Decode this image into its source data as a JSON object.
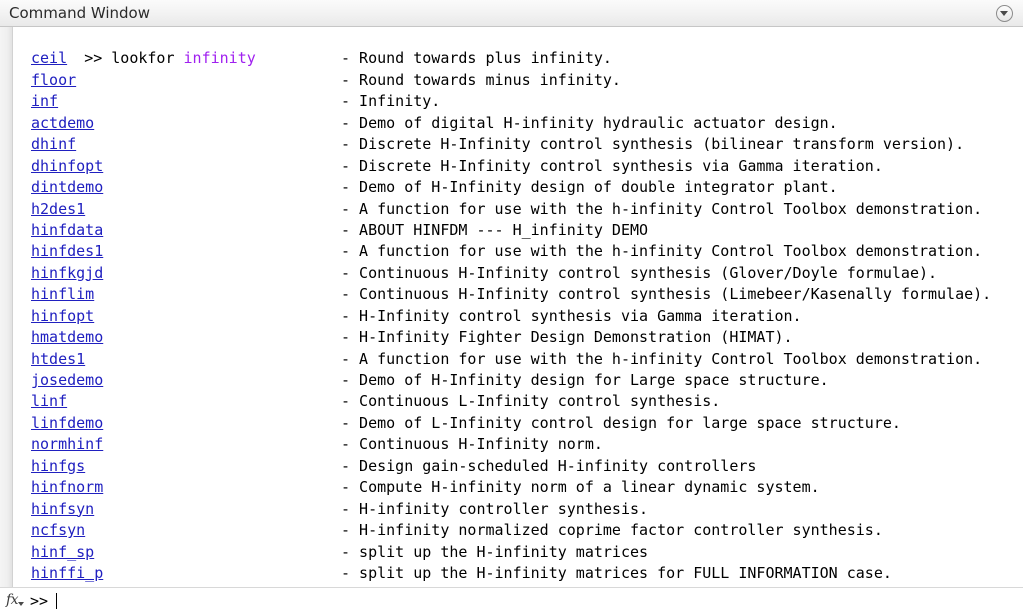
{
  "window": {
    "title": "Command Window",
    "menu_icon": "chevron-down-circle-icon"
  },
  "command": {
    "prompt": ">> ",
    "name": "lookfor",
    "space": " ",
    "argument": "infinity",
    "accent_color": "#a020f0"
  },
  "results": {
    "link_color": "#2020c0",
    "items": [
      {
        "name": "ceil",
        "desc": "- Round towards plus infinity."
      },
      {
        "name": "floor",
        "desc": "- Round towards minus infinity."
      },
      {
        "name": "inf",
        "desc": "- Infinity."
      },
      {
        "name": "actdemo",
        "desc": "- Demo of digital H-infinity hydraulic actuator design."
      },
      {
        "name": "dhinf",
        "desc": "- Discrete H-Infinity control synthesis (bilinear transform version)."
      },
      {
        "name": "dhinfopt",
        "desc": "- Discrete H-Infinity control synthesis via Gamma iteration."
      },
      {
        "name": "dintdemo",
        "desc": "- Demo of H-Infinity design of double integrator plant."
      },
      {
        "name": "h2des1",
        "desc": "- A function for use with the h-infinity Control Toolbox demonstration."
      },
      {
        "name": "hinfdata",
        "desc": "- ABOUT HINFDM --- H_infinity DEMO"
      },
      {
        "name": "hinfdes1",
        "desc": "- A function for use with the h-infinity Control Toolbox demonstration."
      },
      {
        "name": "hinfkgjd",
        "desc": "- Continuous H-Infinity control synthesis (Glover/Doyle formulae)."
      },
      {
        "name": "hinflim",
        "desc": "- Continuous H-Infinity control synthesis (Limebeer/Kasenally formulae)."
      },
      {
        "name": "hinfopt",
        "desc": "- H-Infinity control synthesis via Gamma iteration."
      },
      {
        "name": "hmatdemo",
        "desc": "- H-Infinity Fighter Design Demonstration (HIMAT)."
      },
      {
        "name": "htdes1",
        "desc": "- A function for use with the h-infinity Control Toolbox demonstration."
      },
      {
        "name": "josedemo",
        "desc": "- Demo of H-Infinity design for Large space structure."
      },
      {
        "name": "linf",
        "desc": "- Continuous L-Infinity control synthesis."
      },
      {
        "name": "linfdemo",
        "desc": "- Demo of L-Infinity control design for large space structure."
      },
      {
        "name": "normhinf",
        "desc": "- Continuous H-Infinity norm."
      },
      {
        "name": "hinfgs",
        "desc": "- Design gain-scheduled H-infinity controllers"
      },
      {
        "name": "hinfnorm",
        "desc": "- Compute H-infinity norm of a linear dynamic system."
      },
      {
        "name": "hinfsyn",
        "desc": "- H-infinity controller synthesis."
      },
      {
        "name": "ncfsyn",
        "desc": "- H-infinity normalized coprime factor controller synthesis."
      },
      {
        "name": "hinf_sp",
        "desc": "- split up the H-infinity matrices"
      },
      {
        "name": "hinffi_p",
        "desc": "- split up the H-infinity matrices for FULL INFORMATION case."
      }
    ]
  },
  "footer": {
    "fx_label": "fx",
    "prompt": ">>"
  }
}
